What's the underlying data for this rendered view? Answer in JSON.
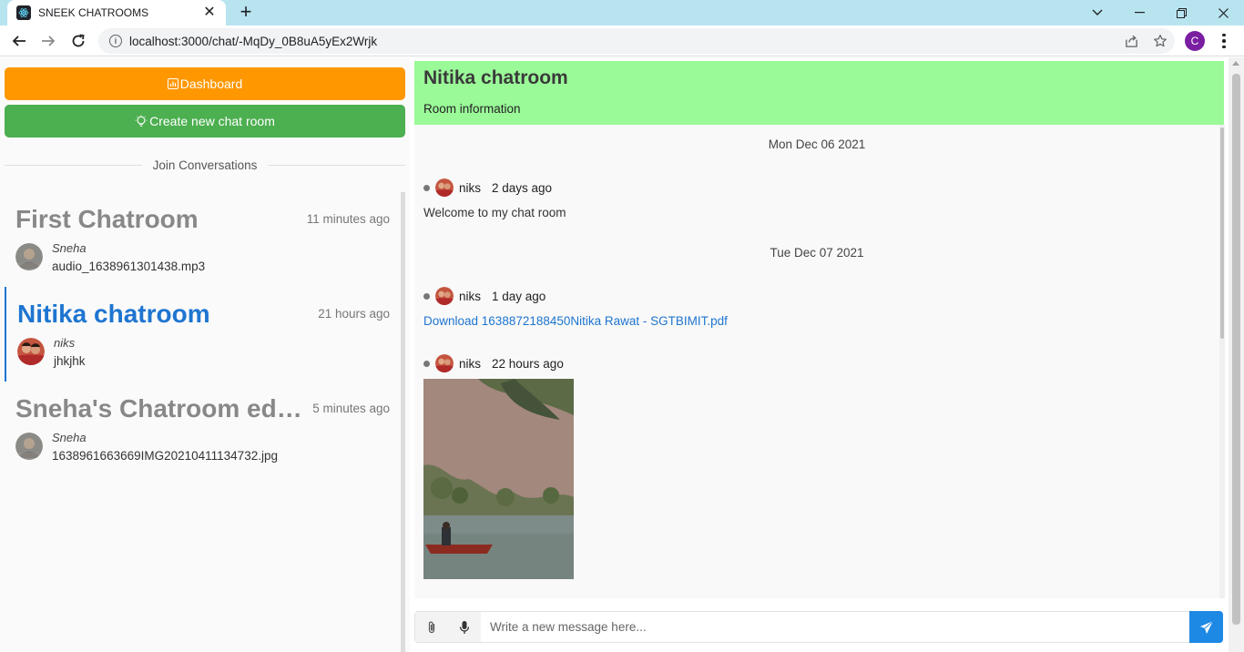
{
  "browser": {
    "tab_title": "SNEEK CHATROOMS",
    "tab_close": "✕",
    "new_tab": "+",
    "url": "localhost:3000/chat/-MqDy_0B8uA5yEx2Wrjk",
    "profile_initial": "C"
  },
  "sidebar": {
    "dashboard_label": "Dashboard",
    "create_label": "Create new chat room",
    "divider_label": "Join Conversations",
    "rooms": [
      {
        "name": "First Chatroom",
        "time": "11 minutes ago",
        "sender": "Sneha",
        "last_message": "audio_1638961301438.mp3",
        "active": false
      },
      {
        "name": "Nitika chatroom",
        "time": "21 hours ago",
        "sender": "niks",
        "last_message": "jhkjhk",
        "active": true
      },
      {
        "name": "Sneha's Chatroom edit...",
        "time": "5 minutes ago",
        "sender": "Sneha",
        "last_message": "1638961663669IMG20210411134732.jpg",
        "active": false
      }
    ]
  },
  "chat": {
    "title": "Nitika chatroom",
    "info_label": "Room information",
    "dates": [
      "Mon Dec 06 2021",
      "Tue Dec 07 2021"
    ],
    "messages": [
      {
        "author": "niks",
        "time": "2 days ago",
        "type": "text",
        "text": "Welcome to my chat room"
      },
      {
        "author": "niks",
        "time": "1 day ago",
        "type": "link",
        "text": "Download 1638872188450Nitika Rawat - SGTBIMIT.pdf"
      },
      {
        "author": "niks",
        "time": "22 hours ago",
        "type": "image",
        "text": ""
      }
    ],
    "composer_placeholder": "Write a new message here..."
  },
  "colors": {
    "dashboard_button": "#ff9800",
    "create_button": "#4caf50",
    "header_bg": "#9afa98",
    "accent": "#1e75d0"
  }
}
